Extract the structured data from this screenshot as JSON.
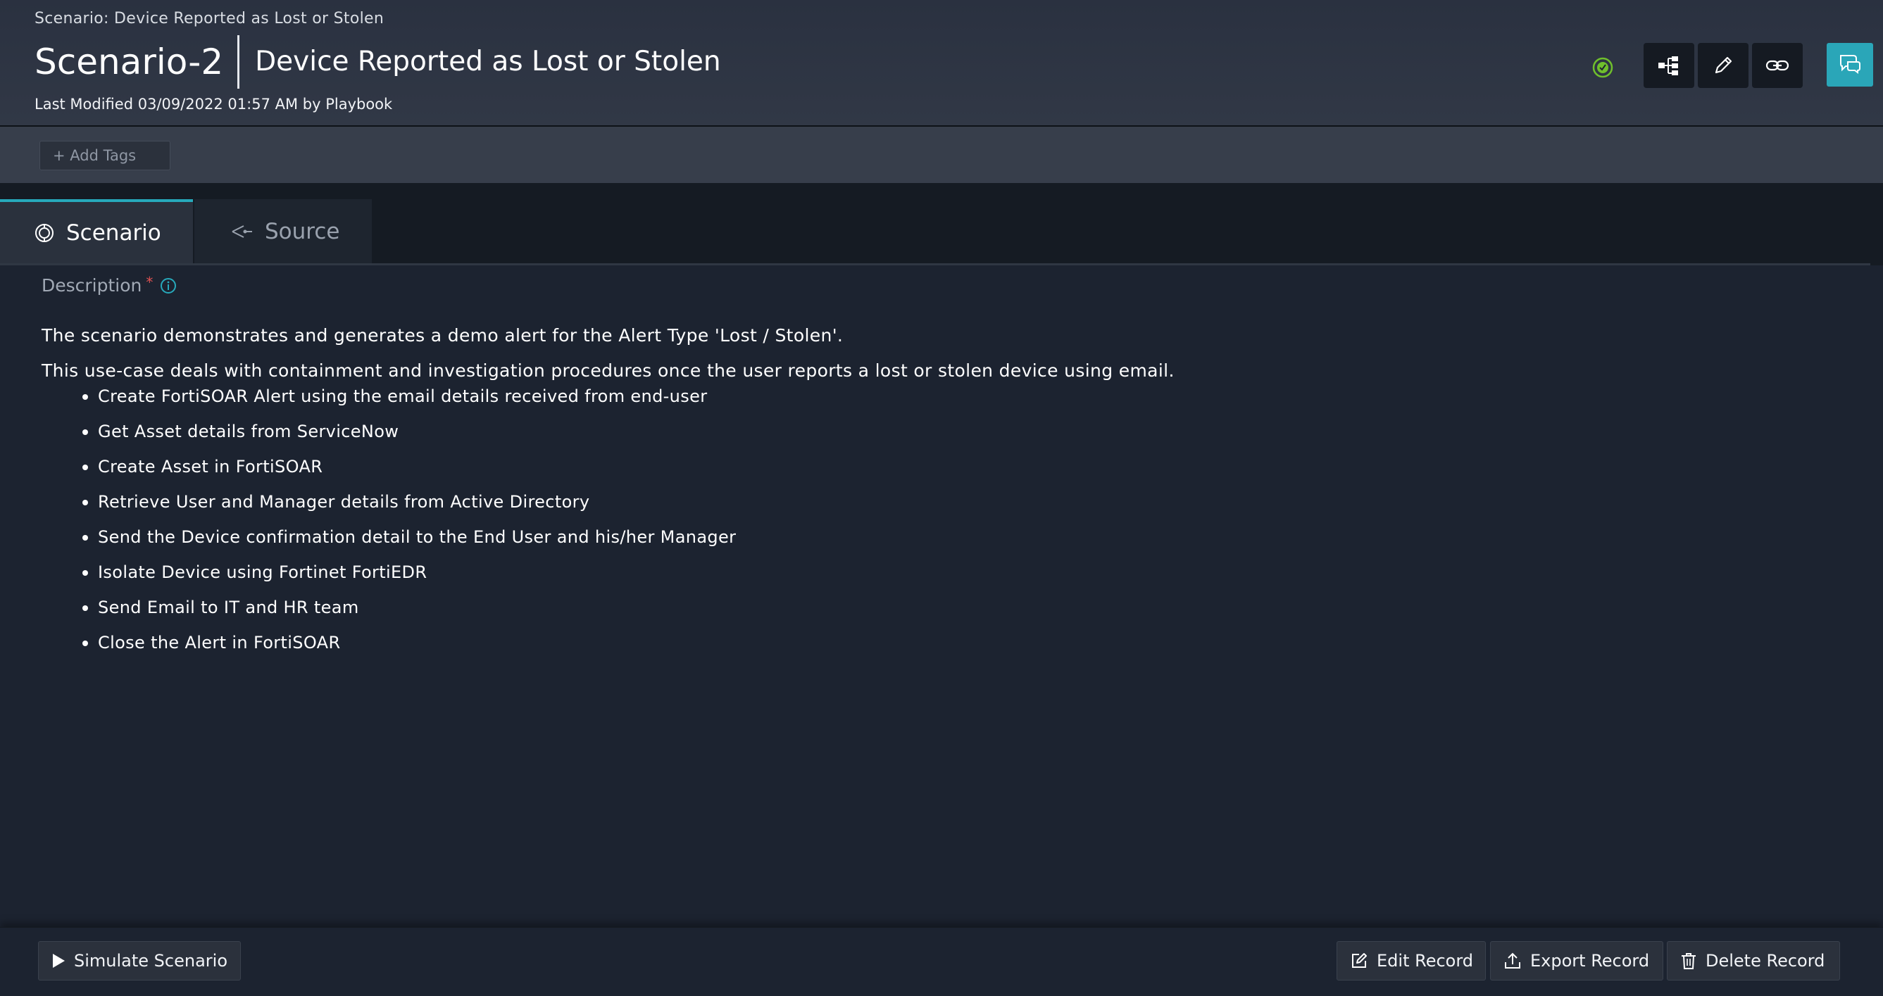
{
  "header": {
    "breadcrumb": "Scenario: Device Reported as Lost or Stolen",
    "record_id": "Scenario-2",
    "record_name": "Device Reported as Lost or Stolen",
    "last_modified": "Last Modified 03/09/2022 01:57 AM by Playbook",
    "status_color": "#6fbf2c",
    "actions": [
      {
        "name": "hierarchy-icon"
      },
      {
        "name": "pencil-icon"
      },
      {
        "name": "link-icon"
      }
    ],
    "chat_icon": "chat-bubble-icon",
    "accent_color": "#2aa6b8"
  },
  "tags": {
    "add_label": "+ Add Tags"
  },
  "tabs": [
    {
      "label": "Scenario",
      "icon": "circle-icon",
      "active": true
    },
    {
      "label": "Source",
      "icon": "share-icon",
      "active": false
    }
  ],
  "description": {
    "label": "Description",
    "required_mark": "*",
    "intro": "The scenario demonstrates and generates a demo alert for the Alert Type 'Lost / Stolen'.",
    "detail": "This use-case deals with containment and investigation procedures once the user reports a lost or stolen device using email.",
    "steps": [
      "Create FortiSOAR Alert using the email details received from end-user",
      "Get Asset details from ServiceNow",
      "Create Asset in FortiSOAR",
      "Retrieve User and Manager details from Active Directory",
      "Send the Device confirmation detail to the End User and his/her Manager",
      "Isolate Device using Fortinet FortiEDR",
      "Send Email to IT and HR team",
      "Close the Alert in FortiSOAR"
    ]
  },
  "footer": {
    "simulate_label": "Simulate Scenario",
    "edit_label": "Edit Record",
    "export_label": "Export Record",
    "delete_label": "Delete Record"
  }
}
